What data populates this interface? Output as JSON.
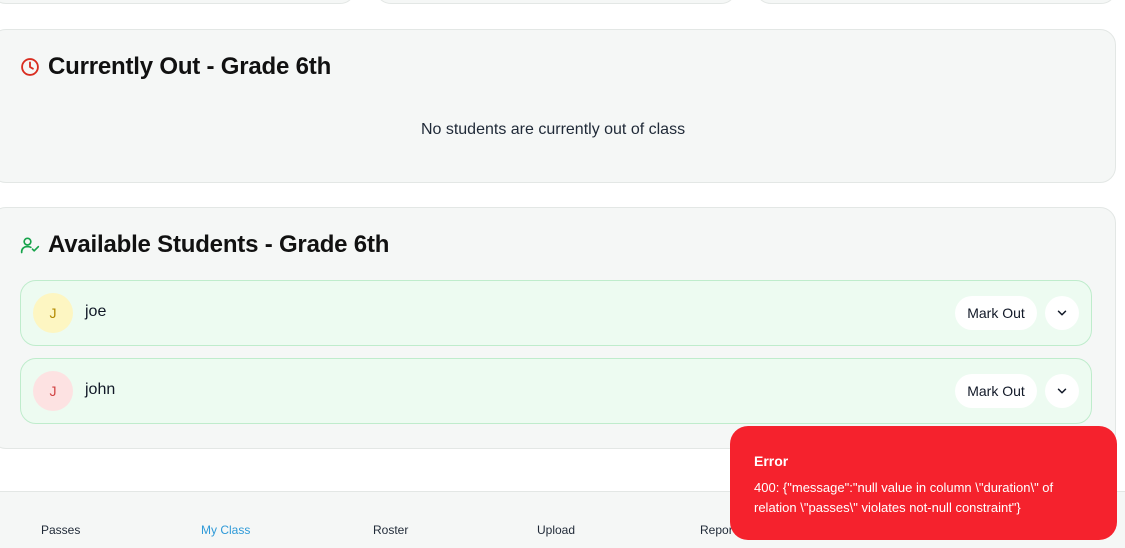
{
  "currently_out": {
    "title": "Currently Out - Grade 6th",
    "icon": "clock-icon",
    "empty_message": "No students are currently out of class",
    "accent": "#d92d20"
  },
  "available": {
    "title": "Available Students - Grade 6th",
    "icon": "user-check-icon",
    "accent": "#16a34a",
    "students": [
      {
        "initial": "J",
        "name": "joe",
        "avatar_bg": "#fdf6c2",
        "avatar_fg": "#b38a00",
        "action": "Mark Out"
      },
      {
        "initial": "J",
        "name": "john",
        "avatar_bg": "#fde2e2",
        "avatar_fg": "#d14343",
        "action": "Mark Out"
      }
    ]
  },
  "nav": {
    "items": [
      "Passes",
      "My Class",
      "Roster",
      "Upload",
      "Repor"
    ],
    "active": "My Class",
    "active_color": "#2f9ad8"
  },
  "toast": {
    "title": "Error",
    "message": "400: {\"message\":\"null value in column \\\"duration\\\" of relation \\\"passes\\\" violates not-null constraint\"}",
    "color": "#f5222d"
  }
}
